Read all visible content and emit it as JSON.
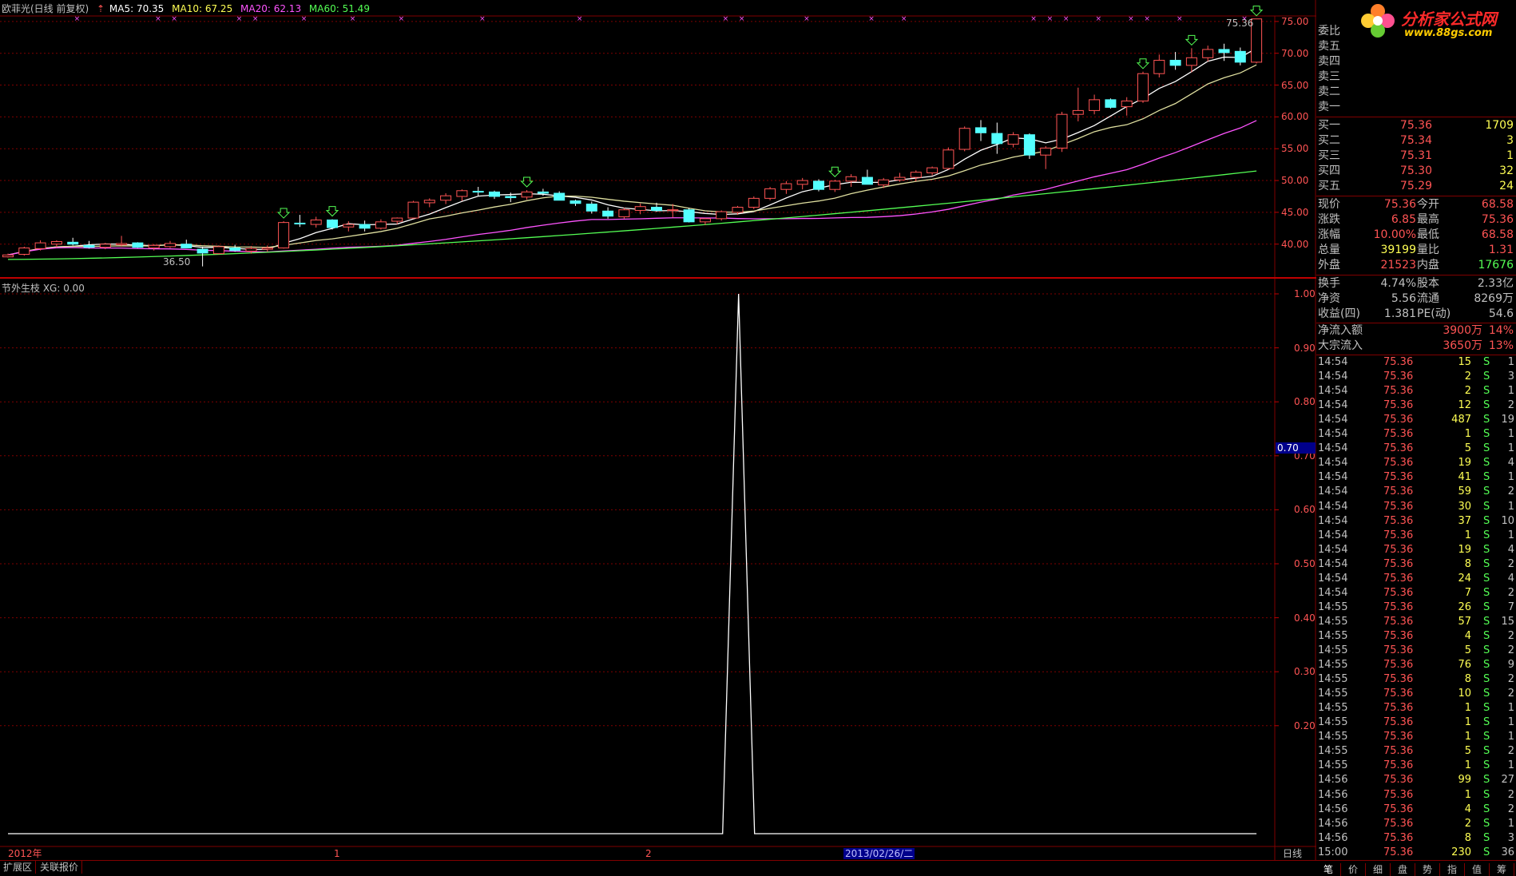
{
  "header": {
    "title": "欧菲光(日线 前复权)",
    "ma5": "MA5: 70.35",
    "ma10": "MA10: 67.25",
    "ma20": "MA20: 62.13",
    "ma60": "MA60: 51.49"
  },
  "price_axis": [
    "75.00",
    "70.00",
    "65.00",
    "60.00",
    "55.00",
    "50.00",
    "45.00",
    "40.00"
  ],
  "price_high_label": "75.36",
  "price_low_label": "36.50",
  "indicator": {
    "title": "节外生枝 XG: 0.00",
    "axis": [
      "1.00",
      "0.90",
      "0.80",
      "0.70",
      "0.60",
      "0.50",
      "0.40",
      "0.30",
      "0.20"
    ],
    "current_marker": "0.70"
  },
  "time_axis": {
    "year": "2012年",
    "m1": "1",
    "m2": "2",
    "cursor_date": "2013/02/26/二",
    "period": "日线"
  },
  "bottom_tabs": [
    "扩展区",
    "关联报价"
  ],
  "logo": {
    "name": "分析家公式网",
    "url": "www.88gs.com"
  },
  "quote": {
    "weibi_label": "委比",
    "sell_labels": [
      "卖五",
      "卖四",
      "卖三",
      "卖二",
      "卖一"
    ],
    "buy": [
      {
        "label": "买一",
        "price": "75.36",
        "vol": "1709"
      },
      {
        "label": "买二",
        "price": "75.34",
        "vol": "3"
      },
      {
        "label": "买三",
        "price": "75.31",
        "vol": "1"
      },
      {
        "label": "买四",
        "price": "75.30",
        "vol": "32"
      },
      {
        "label": "买五",
        "price": "75.29",
        "vol": "24"
      }
    ],
    "stats": [
      {
        "l1": "现价",
        "v1": "75.36",
        "l2": "今开",
        "v2": "68.58",
        "c1": "red",
        "c2": "red"
      },
      {
        "l1": "涨跌",
        "v1": "6.85",
        "l2": "最高",
        "v2": "75.36",
        "c1": "red",
        "c2": "red"
      },
      {
        "l1": "涨幅",
        "v1": "10.00%",
        "l2": "最低",
        "v2": "68.58",
        "c1": "red",
        "c2": "red"
      },
      {
        "l1": "总量",
        "v1": "39199",
        "l2": "量比",
        "v2": "1.31",
        "c1": "yel",
        "c2": "red"
      },
      {
        "l1": "外盘",
        "v1": "21523",
        "l2": "内盘",
        "v2": "17676",
        "c1": "red",
        "c2": "grn"
      }
    ],
    "stats2": [
      {
        "l1": "换手",
        "v1": "4.74%",
        "l2": "股本",
        "v2": "2.33亿"
      },
      {
        "l1": "净资",
        "v1": "5.56",
        "l2": "流通",
        "v2": "8269万"
      },
      {
        "l1": "收益(四)",
        "v1": "1.381",
        "l2": "PE(动)",
        "v2": "54.6"
      }
    ],
    "flow": [
      {
        "label": "净流入额",
        "value": "3900万",
        "pct": "14%"
      },
      {
        "label": "大宗流入",
        "value": "3650万",
        "pct": "13%"
      }
    ]
  },
  "ticks": [
    [
      "14:54",
      "75.36",
      "15",
      "S",
      "1"
    ],
    [
      "14:54",
      "75.36",
      "2",
      "S",
      "3"
    ],
    [
      "14:54",
      "75.36",
      "2",
      "S",
      "1"
    ],
    [
      "14:54",
      "75.36",
      "12",
      "S",
      "2"
    ],
    [
      "14:54",
      "75.36",
      "487",
      "S",
      "19"
    ],
    [
      "14:54",
      "75.36",
      "1",
      "S",
      "1"
    ],
    [
      "14:54",
      "75.36",
      "5",
      "S",
      "1"
    ],
    [
      "14:54",
      "75.36",
      "19",
      "S",
      "4"
    ],
    [
      "14:54",
      "75.36",
      "41",
      "S",
      "1"
    ],
    [
      "14:54",
      "75.36",
      "59",
      "S",
      "2"
    ],
    [
      "14:54",
      "75.36",
      "30",
      "S",
      "1"
    ],
    [
      "14:54",
      "75.36",
      "37",
      "S",
      "10"
    ],
    [
      "14:54",
      "75.36",
      "1",
      "S",
      "1"
    ],
    [
      "14:54",
      "75.36",
      "19",
      "S",
      "4"
    ],
    [
      "14:54",
      "75.36",
      "8",
      "S",
      "2"
    ],
    [
      "14:54",
      "75.36",
      "24",
      "S",
      "4"
    ],
    [
      "14:54",
      "75.36",
      "7",
      "S",
      "2"
    ],
    [
      "14:55",
      "75.36",
      "26",
      "S",
      "7"
    ],
    [
      "14:55",
      "75.36",
      "57",
      "S",
      "15"
    ],
    [
      "14:55",
      "75.36",
      "4",
      "S",
      "2"
    ],
    [
      "14:55",
      "75.36",
      "5",
      "S",
      "2"
    ],
    [
      "14:55",
      "75.36",
      "76",
      "S",
      "9"
    ],
    [
      "14:55",
      "75.36",
      "8",
      "S",
      "2"
    ],
    [
      "14:55",
      "75.36",
      "10",
      "S",
      "2"
    ],
    [
      "14:55",
      "75.36",
      "1",
      "S",
      "1"
    ],
    [
      "14:55",
      "75.36",
      "1",
      "S",
      "1"
    ],
    [
      "14:55",
      "75.36",
      "1",
      "S",
      "1"
    ],
    [
      "14:55",
      "75.36",
      "5",
      "S",
      "2"
    ],
    [
      "14:55",
      "75.36",
      "1",
      "S",
      "1"
    ],
    [
      "14:56",
      "75.36",
      "99",
      "S",
      "27"
    ],
    [
      "14:56",
      "75.36",
      "1",
      "S",
      "2"
    ],
    [
      "14:56",
      "75.36",
      "4",
      "S",
      "2"
    ],
    [
      "14:56",
      "75.36",
      "2",
      "S",
      "1"
    ],
    [
      "14:56",
      "75.36",
      "8",
      "S",
      "3"
    ],
    [
      "15:00",
      "75.36",
      "230",
      "S",
      "36"
    ]
  ],
  "side_tabs": [
    "笔",
    "价",
    "细",
    "盘",
    "势",
    "指",
    "值",
    "筹"
  ],
  "colors": {
    "up": "#ff5454",
    "down": "#54ffff",
    "ma5": "#ffffff",
    "ma10": "#ffff54",
    "ma20": "#ff54ff",
    "ma60": "#54ff54",
    "grid": "#800000"
  },
  "candles": [
    [
      38.0,
      38.5,
      37.9,
      38.3
    ],
    [
      38.4,
      39.6,
      38.2,
      39.4
    ],
    [
      39.3,
      40.6,
      39.0,
      40.2
    ],
    [
      40.0,
      40.6,
      39.5,
      40.4
    ],
    [
      40.3,
      41.0,
      39.8,
      40.0
    ],
    [
      39.8,
      40.5,
      39.3,
      39.5
    ],
    [
      39.5,
      40.2,
      39.2,
      40.0
    ],
    [
      39.9,
      41.3,
      39.6,
      40.1
    ],
    [
      40.2,
      40.3,
      39.4,
      39.5
    ],
    [
      39.4,
      40.0,
      39.0,
      39.8
    ],
    [
      39.6,
      40.5,
      39.4,
      40.1
    ],
    [
      40.0,
      40.7,
      39.7,
      39.4
    ],
    [
      39.2,
      39.6,
      36.5,
      38.6
    ],
    [
      38.5,
      39.8,
      38.4,
      39.6
    ],
    [
      39.4,
      39.9,
      38.8,
      39.0
    ],
    [
      38.9,
      39.7,
      38.5,
      39.3
    ],
    [
      39.2,
      39.8,
      38.8,
      39.4
    ],
    [
      39.4,
      43.6,
      39.3,
      43.4
    ],
    [
      43.3,
      44.6,
      42.7,
      43.2
    ],
    [
      43.1,
      44.3,
      42.6,
      43.8
    ],
    [
      43.8,
      43.9,
      42.3,
      42.6
    ],
    [
      42.7,
      43.6,
      42.0,
      43.1
    ],
    [
      43.1,
      43.7,
      42.0,
      42.5
    ],
    [
      42.5,
      43.9,
      42.3,
      43.5
    ],
    [
      43.6,
      44.2,
      43.1,
      44.1
    ],
    [
      44.1,
      46.8,
      44.0,
      46.6
    ],
    [
      46.5,
      47.2,
      45.8,
      46.9
    ],
    [
      46.9,
      48.0,
      46.3,
      47.6
    ],
    [
      47.5,
      48.6,
      46.8,
      48.4
    ],
    [
      48.3,
      49.0,
      47.6,
      48.2
    ],
    [
      48.2,
      48.4,
      47.1,
      47.5
    ],
    [
      47.5,
      48.1,
      46.6,
      47.3
    ],
    [
      47.4,
      48.5,
      47.0,
      48.2
    ],
    [
      48.2,
      48.7,
      47.6,
      48.0
    ],
    [
      48.0,
      48.3,
      46.9,
      46.9
    ],
    [
      46.8,
      47.0,
      46.0,
      46.4
    ],
    [
      46.3,
      46.7,
      44.8,
      45.2
    ],
    [
      45.2,
      45.8,
      44.0,
      44.4
    ],
    [
      44.3,
      45.7,
      44.0,
      45.4
    ],
    [
      45.3,
      46.4,
      44.7,
      45.9
    ],
    [
      45.8,
      46.5,
      45.1,
      45.3
    ],
    [
      45.3,
      46.3,
      44.2,
      45.4
    ],
    [
      45.4,
      45.7,
      43.4,
      43.5
    ],
    [
      43.5,
      44.1,
      43.0,
      44.0
    ],
    [
      44.0,
      45.3,
      43.7,
      45.1
    ],
    [
      45.0,
      46.0,
      44.6,
      45.8
    ],
    [
      45.8,
      47.5,
      45.5,
      47.2
    ],
    [
      47.2,
      49.0,
      46.9,
      48.7
    ],
    [
      48.6,
      49.9,
      47.9,
      49.5
    ],
    [
      49.4,
      50.4,
      48.6,
      50.0
    ],
    [
      49.9,
      50.2,
      48.3,
      48.6
    ],
    [
      48.6,
      50.1,
      48.2,
      49.9
    ],
    [
      49.9,
      51.0,
      49.0,
      50.6
    ],
    [
      50.5,
      51.7,
      49.8,
      49.4
    ],
    [
      49.3,
      50.4,
      48.8,
      50.1
    ],
    [
      50.1,
      51.2,
      49.8,
      50.5
    ],
    [
      50.5,
      51.6,
      49.9,
      51.3
    ],
    [
      51.2,
      52.2,
      50.8,
      52.0
    ],
    [
      51.9,
      55.2,
      51.7,
      54.8
    ],
    [
      54.9,
      58.5,
      54.6,
      58.2
    ],
    [
      58.3,
      59.5,
      56.2,
      57.5
    ],
    [
      57.4,
      59.1,
      54.2,
      55.8
    ],
    [
      55.7,
      57.6,
      55.2,
      57.2
    ],
    [
      57.2,
      57.4,
      53.4,
      54.0
    ],
    [
      54.0,
      55.4,
      51.8,
      55.1
    ],
    [
      55.1,
      60.8,
      54.5,
      60.4
    ],
    [
      60.4,
      64.6,
      59.3,
      61.0
    ],
    [
      61.0,
      63.5,
      60.4,
      62.7
    ],
    [
      62.7,
      62.9,
      61.3,
      61.5
    ],
    [
      61.6,
      63.1,
      60.2,
      62.5
    ],
    [
      62.5,
      67.1,
      62.2,
      66.8
    ],
    [
      66.8,
      69.8,
      66.2,
      68.9
    ],
    [
      68.9,
      70.2,
      67.4,
      68.1
    ],
    [
      68.1,
      70.8,
      67.0,
      69.3
    ],
    [
      69.3,
      71.2,
      68.7,
      70.6
    ],
    [
      70.6,
      71.5,
      68.8,
      70.1
    ],
    [
      70.3,
      70.9,
      68.1,
      68.6
    ],
    [
      68.6,
      75.4,
      68.4,
      75.4
    ]
  ],
  "arrows": [
    17,
    20,
    32,
    51,
    70,
    73,
    77
  ],
  "indicator_spike_index": 49
}
